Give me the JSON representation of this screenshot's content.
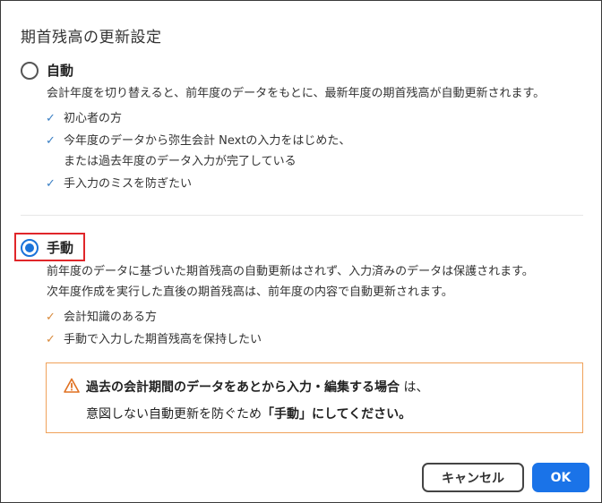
{
  "dialog": {
    "title": "期首残高の更新設定"
  },
  "auto": {
    "label": "自動",
    "description": "会計年度を切り替えると、前年度のデータをもとに、最新年度の期首残高が自動更新されます。",
    "checks": [
      "初心者の方",
      "今年度のデータから弥生会計 Nextの入力をはじめた、",
      "または過去年度のデータ入力が完了している",
      "手入力のミスを防ぎたい"
    ]
  },
  "manual": {
    "label": "手動",
    "description_line1": "前年度のデータに基づいた期首残高の自動更新はされず、入力済みのデータは保護されます。",
    "description_line2": "次年度作成を実行した直後の期首残高は、前年度の内容で自動更新されます。",
    "checks": [
      "会計知識のある方",
      "手動で入力した期首残高を保持したい"
    ]
  },
  "warning": {
    "line1_bold": "過去の会計期間のデータをあとから入力・編集する場合",
    "line1_rest": " は、",
    "line2_prefix": "意図しない自動更新を防ぐため",
    "line2_bold": "「手動」にしてください。"
  },
  "buttons": {
    "cancel": "キャンセル",
    "ok": "OK"
  },
  "colors": {
    "accent": "#1a73e8",
    "highlight_border": "#e0262a",
    "warning_border": "#f0a25a",
    "warning_icon": "#e07020"
  }
}
